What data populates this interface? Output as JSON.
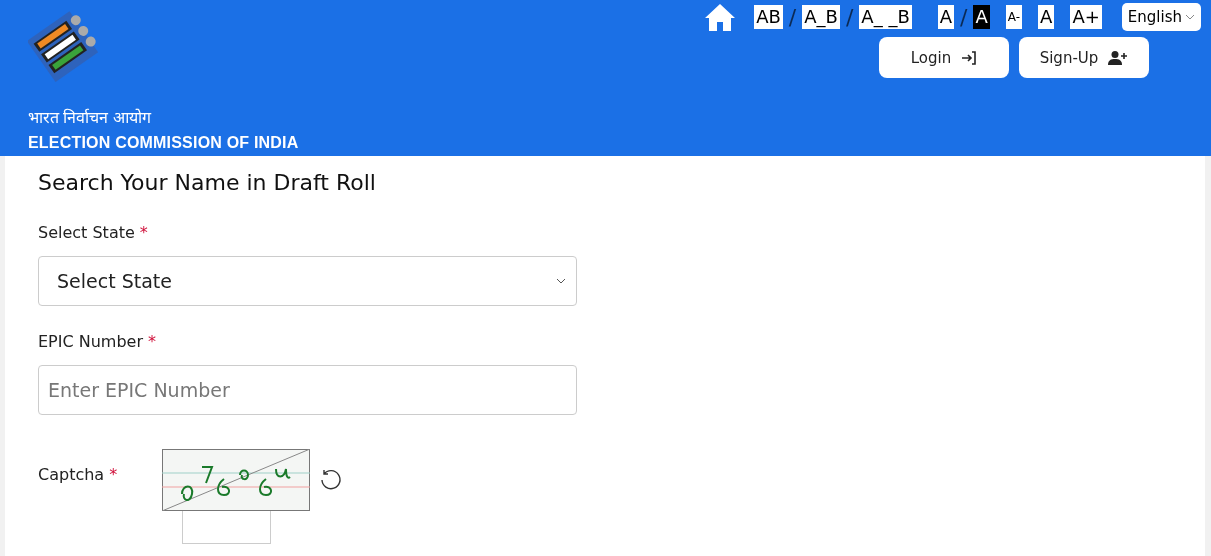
{
  "header": {
    "title_hindi": "भारत निर्वाचन आयोग",
    "title_english": "ELECTION COMMISSION OF INDIA"
  },
  "toolbar": [
    {
      "kind": "spacing",
      "label": "AB"
    },
    {
      "kind": "separator",
      "label": "/"
    },
    {
      "kind": "spacing",
      "label": "A_B"
    },
    {
      "kind": "separator",
      "label": "/"
    },
    {
      "kind": "spacing",
      "label": "A_ _B"
    },
    {
      "kind": "contrast",
      "label": "A",
      "selected": false
    },
    {
      "kind": "separator",
      "label": "/"
    },
    {
      "kind": "contrast",
      "label": "A",
      "selected": true
    },
    {
      "kind": "size",
      "label": "A-"
    },
    {
      "kind": "size",
      "label": "A"
    },
    {
      "kind": "size",
      "label": "A+"
    }
  ],
  "language": {
    "value": "English"
  },
  "buttons": [
    {
      "kind": "login",
      "label": "Login"
    },
    {
      "kind": "signup",
      "label": "Sign-Up"
    }
  ],
  "form": {
    "title": "Search Your Name in Draft Roll",
    "fields": [
      {
        "kind": "select",
        "label": "Select State",
        "required_mark": "*",
        "value": "Select State"
      },
      {
        "kind": "text",
        "label": "EPIC Number",
        "required_mark": "*",
        "placeholder": "Enter EPIC Number"
      },
      {
        "kind": "captcha",
        "label": "Captcha",
        "required_mark": "*"
      }
    ]
  }
}
